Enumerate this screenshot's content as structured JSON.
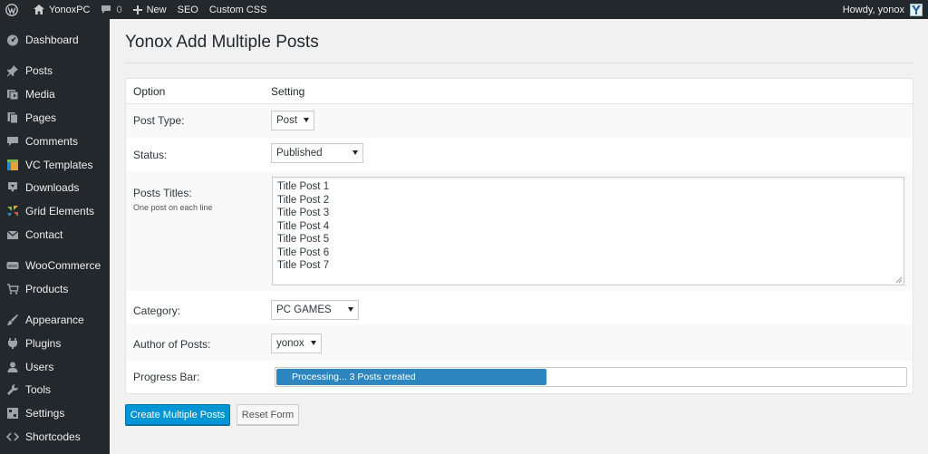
{
  "adminbar": {
    "site_name": "YonoxPC",
    "comments_count": "0",
    "new_label": "New",
    "seo_label": "SEO",
    "custom_css_label": "Custom CSS",
    "howdy": "Howdy, yonox"
  },
  "sidebar": {
    "items": [
      {
        "label": "Dashboard",
        "icon": "dashboard-icon"
      },
      {
        "label": "Posts",
        "icon": "pin-icon"
      },
      {
        "label": "Media",
        "icon": "media-icon"
      },
      {
        "label": "Pages",
        "icon": "pages-icon"
      },
      {
        "label": "Comments",
        "icon": "comment-icon"
      },
      {
        "label": "VC Templates",
        "icon": "vc-templates-icon"
      },
      {
        "label": "Downloads",
        "icon": "downloads-icon"
      },
      {
        "label": "Grid Elements",
        "icon": "grid-elements-icon"
      },
      {
        "label": "Contact",
        "icon": "mail-icon"
      },
      {
        "label": "WooCommerce",
        "icon": "woocommerce-icon"
      },
      {
        "label": "Products",
        "icon": "cart-icon"
      },
      {
        "label": "Appearance",
        "icon": "brush-icon"
      },
      {
        "label": "Plugins",
        "icon": "plugin-icon"
      },
      {
        "label": "Users",
        "icon": "user-icon"
      },
      {
        "label": "Tools",
        "icon": "wrench-icon"
      },
      {
        "label": "Settings",
        "icon": "settings-icon"
      },
      {
        "label": "Shortcodes",
        "icon": "code-icon"
      }
    ]
  },
  "page": {
    "title": "Yonox Add Multiple Posts"
  },
  "form": {
    "header_option": "Option",
    "header_setting": "Setting",
    "post_type": {
      "label": "Post Type:",
      "value": "Post"
    },
    "status": {
      "label": "Status:",
      "value": "Published"
    },
    "titles": {
      "label": "Posts Titles:",
      "hint": "One post on each line",
      "lines": [
        "Title Post 1",
        "Title Post 2",
        "Title Post 3",
        "Title Post 4",
        "Title Post 5",
        "Title Post 6",
        "Title Post 7"
      ]
    },
    "category": {
      "label": "Category:",
      "value": "PC GAMES"
    },
    "author": {
      "label": "Author of Posts:",
      "value": "yonox"
    },
    "progress": {
      "label": "Progress Bar:",
      "text": "Processing... 3 Posts created",
      "fraction": 0.43
    }
  },
  "buttons": {
    "create": "Create Multiple Posts",
    "reset": "Reset Form"
  },
  "colors": {
    "primary": "#0095d5",
    "progress": "#2e86c1",
    "sidebar": "#23282d"
  }
}
